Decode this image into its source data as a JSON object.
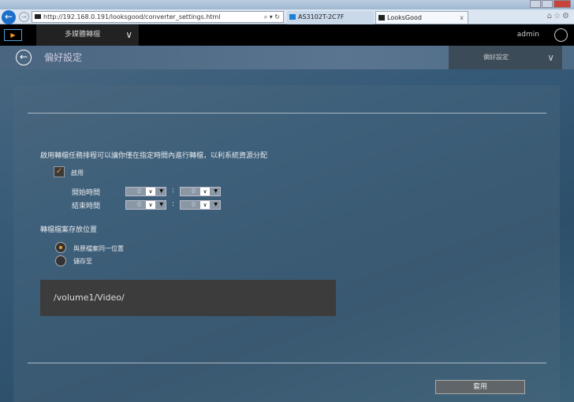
{
  "browser": {
    "back": "←",
    "forward": "→",
    "url": "http://192.168.0.191/looksgood/converter_settings.html",
    "url_controls": "⌕ ▾ ↻",
    "tabs": [
      {
        "label": "AS3102T-2C7F"
      },
      {
        "label": "LooksGood",
        "close": "x"
      }
    ],
    "tools": "⌂☆⚙"
  },
  "app": {
    "logo": "▶",
    "menu_label": "多媒體轉檔",
    "user": "admin"
  },
  "subheader": {
    "title": "偏好設定",
    "dropdown": "偏好設定"
  },
  "schedule": {
    "description": "啟用轉檔任務排程可以讓你僅在指定時間內進行轉檔，以利系統資源分配",
    "enable_label": "啟用",
    "enabled": true,
    "checkmark": "✓",
    "start_label": "開始時間",
    "end_label": "結束時間",
    "start_hour": "0",
    "start_minute": "0",
    "end_hour": "0",
    "end_minute": "0",
    "separator": ":"
  },
  "storage": {
    "title": "轉檔檔案存放位置",
    "options": [
      {
        "label": "與原檔案同一位置",
        "selected": true
      },
      {
        "label": "儲存至",
        "selected": false
      }
    ],
    "path": "/volume1/Video/"
  },
  "apply_label": "套用"
}
